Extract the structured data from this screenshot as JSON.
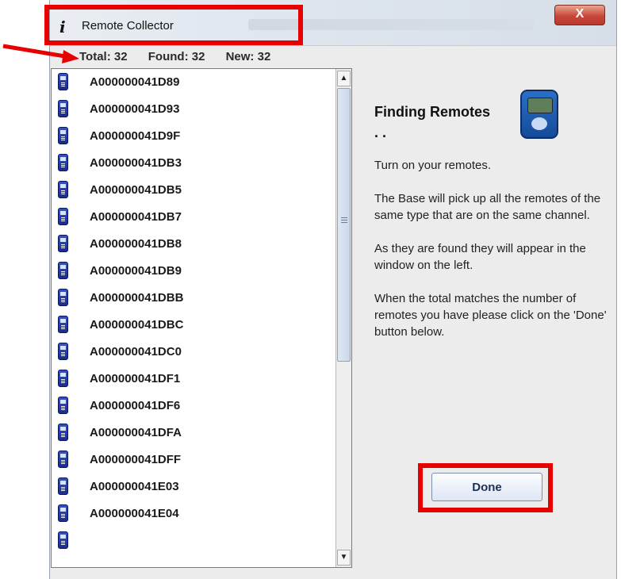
{
  "window": {
    "title": "Remote Collector",
    "app_icon_glyph": "i",
    "close_glyph": "X"
  },
  "summary": {
    "total": "Total: 32",
    "found": "Found: 32",
    "new": "New: 32"
  },
  "remotes": [
    "A000000041D89",
    "A000000041D93",
    "A000000041D9F",
    "A000000041DB3",
    "A000000041DB5",
    "A000000041DB7",
    "A000000041DB8",
    "A000000041DB9",
    "A000000041DBB",
    "A000000041DBC",
    "A000000041DC0",
    "A000000041DF1",
    "A000000041DF6",
    "A000000041DFA",
    "A000000041DFF",
    "A000000041E03",
    "A000000041E04"
  ],
  "panel": {
    "heading": "Finding Remotes . .",
    "paragraphs": [
      "Turn on your remotes.",
      "The Base will pick up all the remotes of the same type that are on the same channel.",
      "As they are found they will appear in the window on the left.",
      "When the total matches the number of remotes you have please click on the 'Done' button below."
    ],
    "done_label": "Done"
  },
  "colors": {
    "highlight": "#e60000",
    "remote_icon": "#2f4fd8"
  },
  "icons": {
    "app": "info-i-icon",
    "close": "close-x-icon",
    "remote": "remote-device-icon",
    "base": "base-station-icon",
    "arrow": "red-arrow-annotation"
  }
}
